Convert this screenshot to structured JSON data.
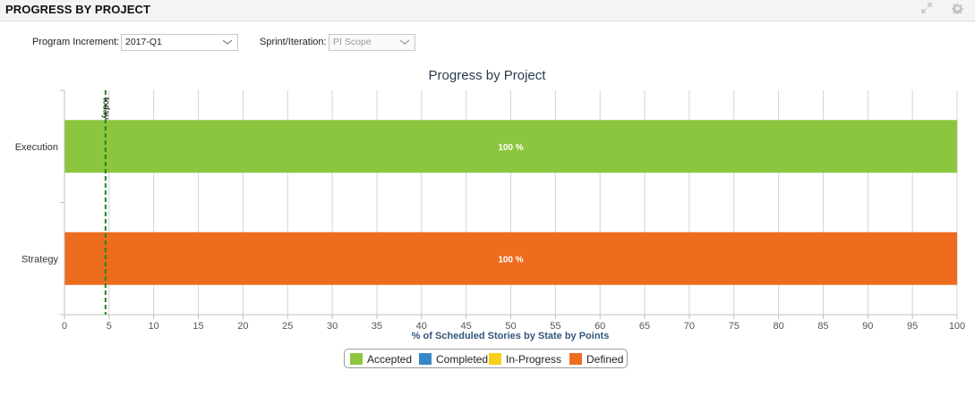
{
  "widget": {
    "title": "PROGRESS BY PROJECT",
    "expand_icon": "expand-icon",
    "settings_icon": "gear-icon"
  },
  "controls": {
    "program_increment_label": "Program Increment:",
    "program_increment_value": "2017-Q1",
    "sprint_label": "Sprint/Iteration:",
    "sprint_value": "PI Scope"
  },
  "colors": {
    "accepted": "#8cc63f",
    "completed": "#3a87c8",
    "in_progress": "#f7d117",
    "defined": "#ee6c1e",
    "today_line": "#1e8a1e"
  },
  "legend": [
    {
      "label": "Accepted",
      "color": "#8cc63f"
    },
    {
      "label": "Completed",
      "color": "#3a87c8"
    },
    {
      "label": "In-Progress",
      "color": "#f7d117"
    },
    {
      "label": "Defined",
      "color": "#ee6c1e"
    }
  ],
  "chart_data": {
    "type": "bar",
    "orientation": "horizontal",
    "stacked": true,
    "title": "Progress by Project",
    "xlabel": "% of Scheduled Stories by State by Points",
    "ylabel": "",
    "xlim": [
      0,
      100
    ],
    "x_ticks": [
      "0",
      "5",
      "10",
      "15",
      "20",
      "25",
      "30",
      "35",
      "40",
      "45",
      "50",
      "55",
      "60",
      "65",
      "70",
      "75",
      "80",
      "85",
      "90",
      "95",
      "100"
    ],
    "categories": [
      "Execution",
      "Strategy"
    ],
    "series": [
      {
        "name": "Accepted",
        "values": [
          100,
          0
        ]
      },
      {
        "name": "Completed",
        "values": [
          0,
          0
        ]
      },
      {
        "name": "In-Progress",
        "values": [
          0,
          0
        ]
      },
      {
        "name": "Defined",
        "values": [
          0,
          100
        ]
      }
    ],
    "data_labels": [
      "100 %",
      "100 %"
    ],
    "grid": true,
    "legend_position": "bottom",
    "today_marker": {
      "label": "today",
      "value": 4.6
    }
  }
}
